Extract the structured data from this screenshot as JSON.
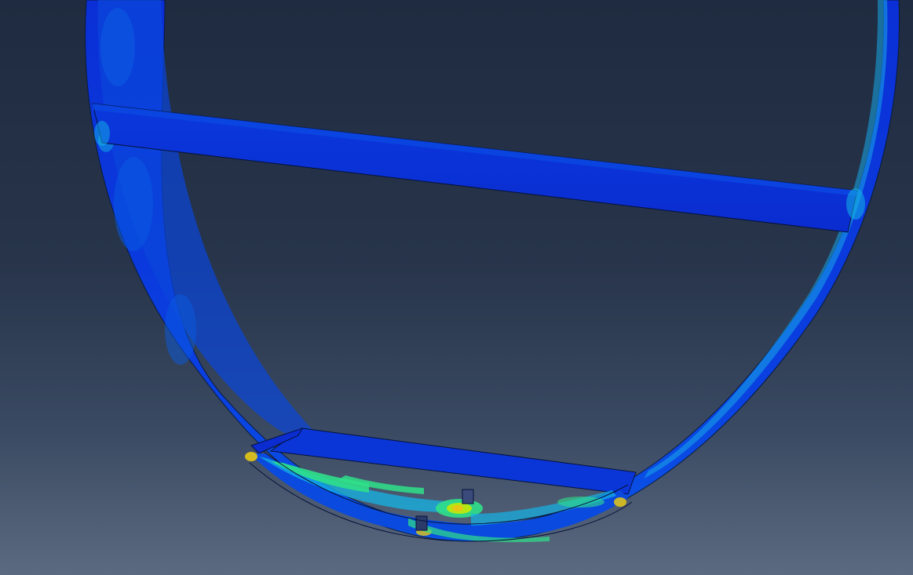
{
  "viewport": {
    "background_top": "#1f2b40",
    "background_bottom": "#5c6a80",
    "contour_colors": {
      "low": "#0a2fd6",
      "low_mid": "#0a5ae0",
      "mid": "#14b4e6",
      "mid_high": "#2fe08a",
      "high": "#b4e614",
      "peak": "#e6c814"
    }
  }
}
